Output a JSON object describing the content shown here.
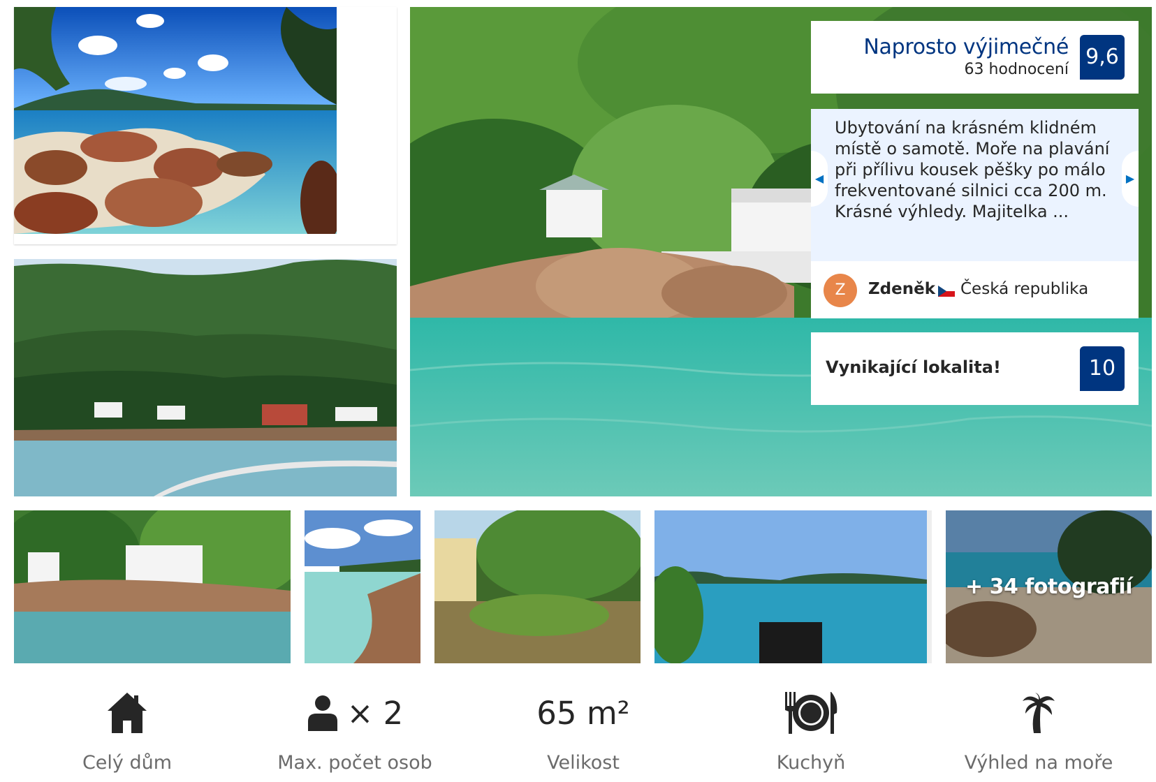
{
  "gallery": {
    "more_photos_label": "+ 34 fotografií"
  },
  "review_panel": {
    "score_title": "Naprosto výjimečné",
    "score_count": "63 hodnocení",
    "score_value": "9,6",
    "review_text": "Ubytování na krásném klidném místě o samotě. Moře na plavání při přílivu kousek pěšky po málo frekventované silnici cca 200 m. Krásné výhledy. Majitelka ...",
    "reviewer_initial": "Z",
    "reviewer_name": "Zdeněk",
    "reviewer_country": "Česká republika",
    "location_label": "Vynikající lokalita!",
    "location_score": "10"
  },
  "facilities": {
    "house_label": "Celý dům",
    "max_guests_value": "× 2",
    "max_guests_label": "Max. počet osob",
    "size_value": "65 m²",
    "size_label": "Velikost",
    "kitchen_label": "Kuchyň",
    "sea_view_label": "Výhled na moře"
  },
  "colors": {
    "brand_blue": "#003580",
    "review_bg": "#ebf3ff",
    "avatar_orange": "#e8864a"
  },
  "icons": {
    "house": "house-icon",
    "person": "person-icon",
    "kitchen": "kitchen-icon",
    "palm": "palm-tree-icon"
  }
}
